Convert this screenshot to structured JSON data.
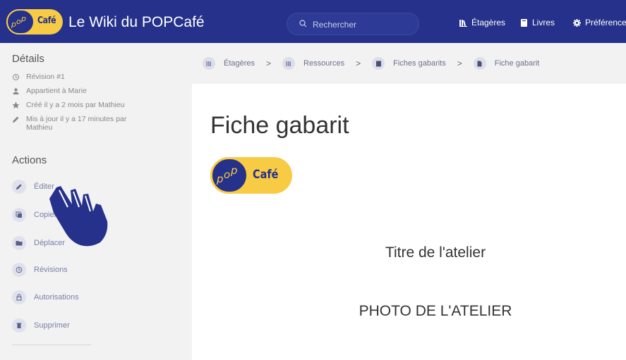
{
  "header": {
    "logo_text": "Café",
    "logo_mark": "pop",
    "title": "Le Wiki du POPCafé",
    "search_placeholder": "Rechercher",
    "nav": [
      {
        "label": "Étagères",
        "icon": "shelves-icon"
      },
      {
        "label": "Livres",
        "icon": "book-icon"
      },
      {
        "label": "Préférences",
        "icon": "gear-icon"
      }
    ]
  },
  "sidebar": {
    "details_title": "Détails",
    "details": [
      {
        "text": "Révision #1",
        "icon": "history-icon"
      },
      {
        "text": "Appartient à Marie",
        "icon": "user-icon"
      },
      {
        "text": "Créé il y a 2 mois par Mathieu",
        "icon": "star-icon"
      },
      {
        "text": "Mis à jour il y a 17 minutes par Mathieu",
        "icon": "pencil-icon"
      }
    ],
    "actions_title": "Actions",
    "actions": [
      {
        "label": "Éditer",
        "icon": "edit-icon"
      },
      {
        "label": "Copier",
        "icon": "copy-icon"
      },
      {
        "label": "Déplacer",
        "icon": "folder-icon"
      },
      {
        "label": "Révisions",
        "icon": "history-icon"
      },
      {
        "label": "Autorisations",
        "icon": "lock-icon"
      },
      {
        "label": "Supprimer",
        "icon": "trash-icon"
      }
    ]
  },
  "breadcrumb": [
    {
      "label": "Étagères",
      "icon": "shelves-icon"
    },
    {
      "label": "Ressources",
      "icon": "shelves-icon"
    },
    {
      "label": "Fiches gabarits",
      "icon": "book-icon"
    },
    {
      "label": "Fiche gabarit",
      "icon": "page-icon"
    }
  ],
  "breadcrumb_separator": ">",
  "page": {
    "title": "Fiche gabarit",
    "logo_text": "Café",
    "logo_mark": "pop",
    "heading": "Titre de l'atelier",
    "photo_placeholder": "PHOTO DE L'ATELIER"
  },
  "colors": {
    "brand_blue": "#25318a",
    "brand_yellow": "#f8cb45"
  }
}
